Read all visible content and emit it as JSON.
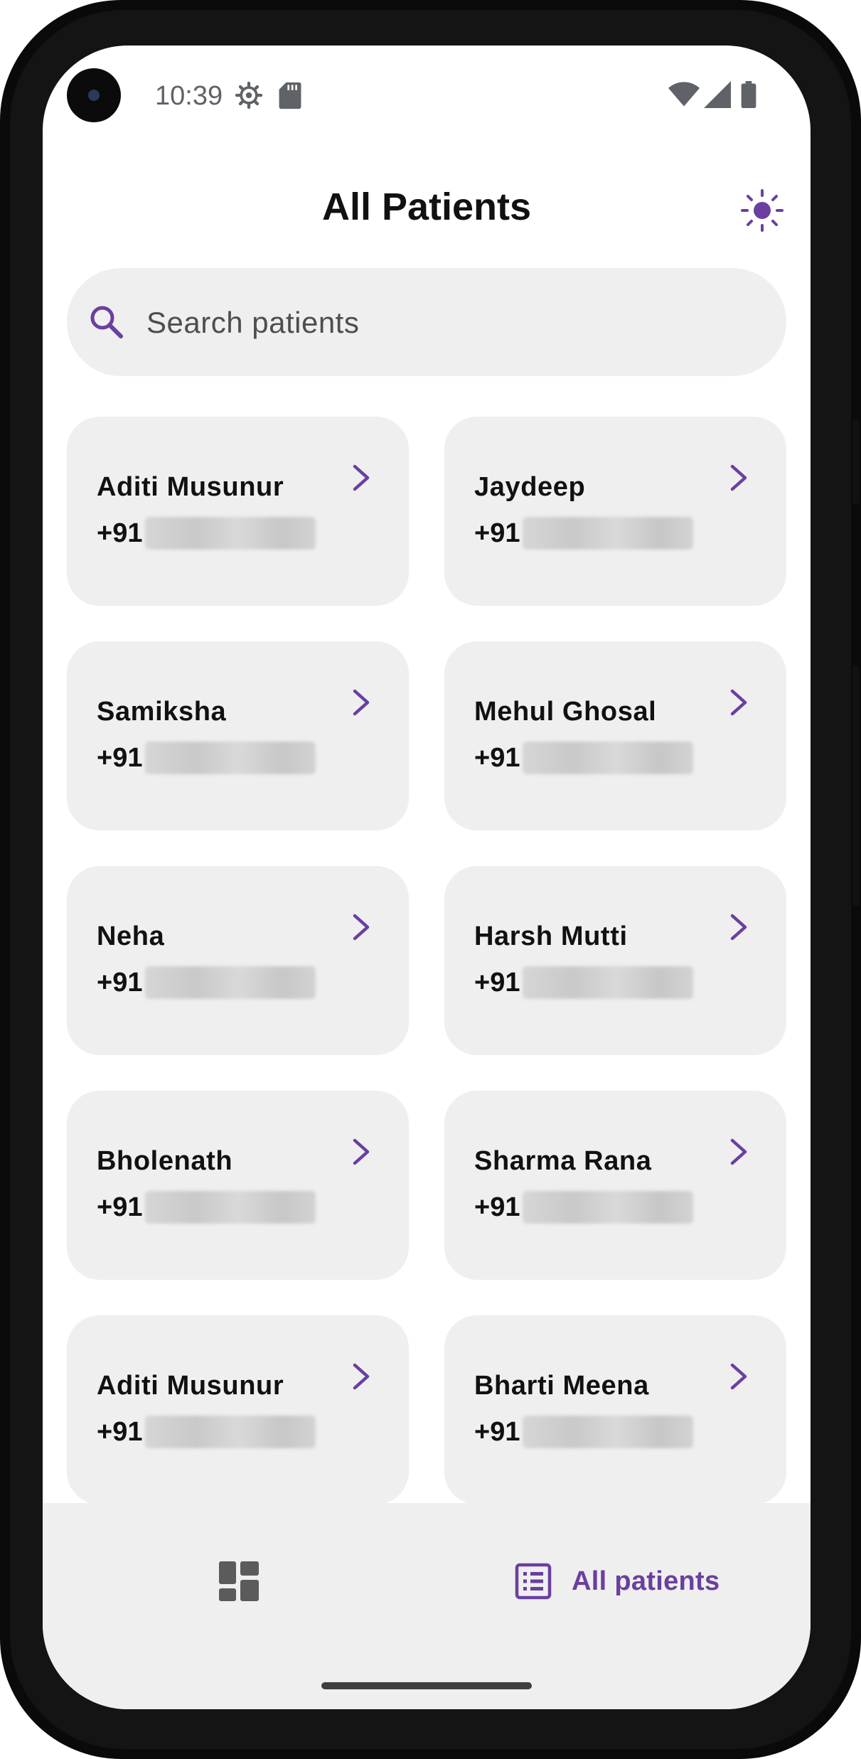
{
  "status_bar": {
    "time": "10:39",
    "icons": [
      "settings-gear-icon",
      "sd-card-icon",
      "wifi-icon",
      "cellular-signal-icon",
      "battery-icon"
    ]
  },
  "header": {
    "title": "All Patients",
    "theme_toggle_icon": "sun-icon"
  },
  "search": {
    "placeholder": "Search patients",
    "value": ""
  },
  "patients": [
    {
      "name": "Aditi Musunur",
      "code": "+91"
    },
    {
      "name": "Jaydeep",
      "code": "+91"
    },
    {
      "name": "Samiksha",
      "code": "+91"
    },
    {
      "name": "Mehul Ghosal",
      "code": "+91"
    },
    {
      "name": "Neha",
      "code": "+91"
    },
    {
      "name": "Harsh Mutti",
      "code": "+91"
    },
    {
      "name": "Bholenath",
      "code": "+91"
    },
    {
      "name": "Sharma Rana",
      "code": "+91"
    },
    {
      "name": "Aditi Musunur",
      "code": "+91"
    },
    {
      "name": "Bharti Meena",
      "code": "+91"
    }
  ],
  "bottom_nav": {
    "dashboard_icon": "dashboard-icon",
    "all_patients_label": "All patients",
    "active": "All patients"
  },
  "colors": {
    "accent": "#6a3fa0",
    "card_bg": "#efefef",
    "text": "#111111"
  }
}
